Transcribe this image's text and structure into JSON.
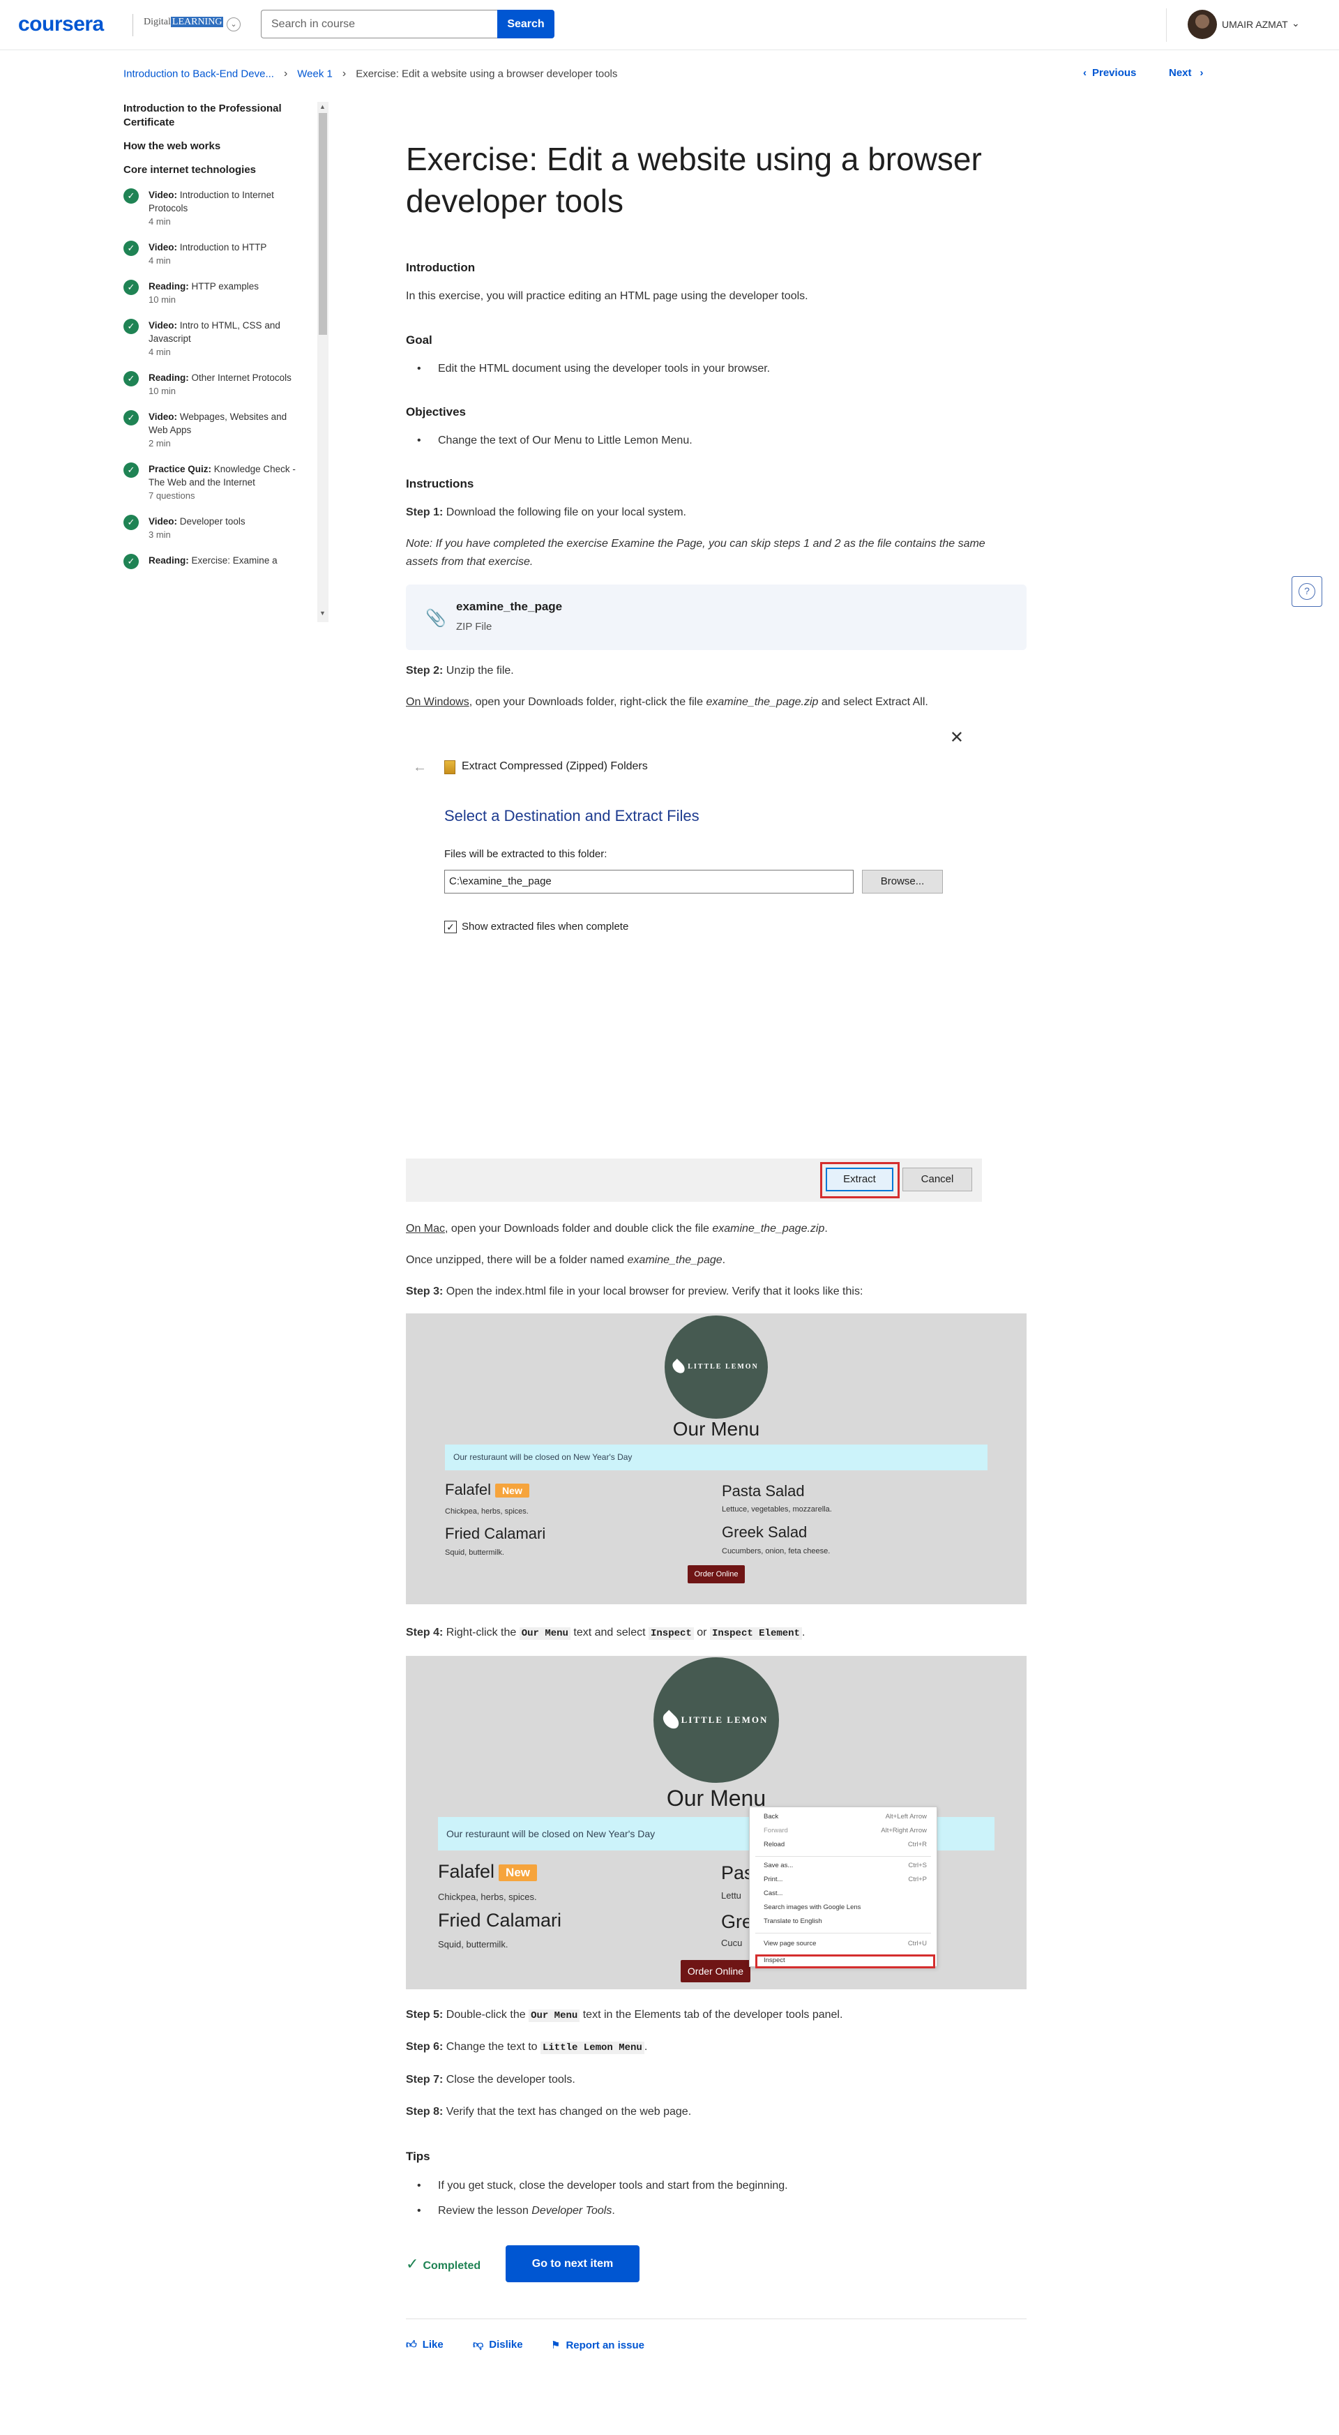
{
  "header": {
    "logo": "coursera",
    "partner_name_prefix": "Digital",
    "partner_name_highlight": "LEARNING",
    "search_placeholder": "Search in course",
    "search_button": "Search",
    "user_name": "UMAIR AZMAT"
  },
  "breadcrumb": {
    "items": [
      "Introduction to Back-End Deve...",
      "Week 1",
      "Exercise: Edit a website using a browser developer tools"
    ],
    "previous": "Previous",
    "next": "Next"
  },
  "sidebar": {
    "sections": [
      "Introduction to the Professional Certificate",
      "How the web works",
      "Core internet technologies"
    ],
    "items": [
      {
        "type": "Video:",
        "title": "Introduction to Internet Protocols",
        "meta": "4 min"
      },
      {
        "type": "Video:",
        "title": "Introduction to HTTP",
        "meta": "4 min"
      },
      {
        "type": "Reading:",
        "title": "HTTP examples",
        "meta": "10 min"
      },
      {
        "type": "Video:",
        "title": "Intro to HTML, CSS and Javascript",
        "meta": "4 min"
      },
      {
        "type": "Reading:",
        "title": "Other Internet Protocols",
        "meta": "10 min"
      },
      {
        "type": "Video:",
        "title": "Webpages, Websites and Web Apps",
        "meta": "2 min"
      },
      {
        "type": "Practice Quiz:",
        "title": "Knowledge Check - The Web and the Internet",
        "meta": "7 questions"
      },
      {
        "type": "Video:",
        "title": "Developer tools",
        "meta": "3 min"
      },
      {
        "type": "Reading:",
        "title": "Exercise: Examine a",
        "meta": ""
      }
    ]
  },
  "content": {
    "title": "Exercise: Edit a website using a browser developer tools",
    "intro_heading": "Introduction",
    "intro_text": "In this exercise, you will practice editing an HTML page using the developer tools.",
    "goal_heading": "Goal",
    "goal_item": "Edit the HTML document using the developer tools in your browser.",
    "objectives_heading": "Objectives",
    "objectives_item": "Change the text of Our Menu to Little Lemon Menu.",
    "instructions_heading": "Instructions",
    "step1_label": "Step 1:",
    "step1_text": " Download the following file on your local system.",
    "note_text": "Note: If you have completed the exercise Examine the Page, you can skip steps 1 and 2 as the file contains the same assets from that exercise.",
    "file_name": "examine_the_page",
    "file_type": "ZIP File",
    "step2_label": "Step 2:",
    "step2_text": " Unzip the file.",
    "windows_link": "On Windows",
    "windows_text_a": ", open your Downloads folder, right-click the file ",
    "windows_file": "examine_the_page.zip",
    "windows_text_b": " and select Extract All.",
    "mac_link": "On Mac",
    "mac_text_a": ", open your Downloads folder and double click the file ",
    "mac_file": "examine_the_page.zip",
    "mac_text_b": ".",
    "unzip_text_a": "Once unzipped, there will be a folder named ",
    "unzip_folder": "examine_the_page",
    "unzip_text_b": ".",
    "step3_label": "Step 3:",
    "step3_text": "  Open the index.html file in your local browser for preview. Verify that it looks like this:",
    "step4_label": "Step 4:",
    "step4_a": " Right-click the ",
    "step4_code1": "Our Menu",
    "step4_b": " text and select ",
    "step4_code2": "Inspect",
    "step4_c": " or ",
    "step4_code3": "Inspect Element",
    "step4_d": ".",
    "step5_label": "Step 5:",
    "step5_a": " Double-click the ",
    "step5_code": "Our Menu",
    "step5_b": " text in the Elements tab of the developer tools panel.",
    "step6_label": "Step 6:",
    "step6_a": " Change the text to ",
    "step6_code": "Little Lemon Menu",
    "step6_b": ".",
    "step7_label": "Step 7:",
    "step7_text": " Close the developer tools.",
    "step8_label": "Step 8:",
    "step8_text": " Verify that the text has changed on the web page.",
    "tips_heading": "Tips",
    "tip1": "If you get stuck, close the developer tools and start from the beginning.",
    "tip2_a": "Review the lesson ",
    "tip2_em": "Developer Tools",
    "tip2_b": "."
  },
  "dialog": {
    "caption": "Extract Compressed (Zipped) Folders",
    "heading": "Select a Destination and Extract Files",
    "label": "Files will be extracted to this folder:",
    "path": "C:\\examine_the_page",
    "browse": "Browse...",
    "checkbox_label": "Show extracted files when complete",
    "extract": "Extract",
    "cancel": "Cancel"
  },
  "little_lemon": {
    "logo_text": "LITTLE LEMON",
    "menu_title": "Our Menu",
    "notice": "Our resturaunt will be closed on New Year's Day",
    "dishes": [
      {
        "name": "Falafel",
        "badge": "New",
        "desc": "Chickpea, herbs, spices."
      },
      {
        "name": "Pasta Salad",
        "badge": "",
        "desc": "Lettuce, vegetables, mozzarella."
      },
      {
        "name": "Fried Calamari",
        "badge": "",
        "desc": "Squid, buttermilk."
      },
      {
        "name": "Greek Salad",
        "badge": "",
        "desc": "Cucumbers, onion, feta cheese."
      }
    ],
    "order_button": "Order Online",
    "partial_pasta": "Pas",
    "partial_pasta_desc": "Lettu",
    "partial_greek": "Gre",
    "partial_greek_desc": "Cucu"
  },
  "context_menu": {
    "items": [
      {
        "label": "Back",
        "shortcut": "Alt+Left Arrow"
      },
      {
        "label": "Forward",
        "shortcut": "Alt+Right Arrow"
      },
      {
        "label": "Reload",
        "shortcut": "Ctrl+R"
      },
      {
        "label": "Save as...",
        "shortcut": "Ctrl+S"
      },
      {
        "label": "Print...",
        "shortcut": "Ctrl+P"
      },
      {
        "label": "Cast...",
        "shortcut": ""
      },
      {
        "label": "Search images with Google Lens",
        "shortcut": ""
      },
      {
        "label": "Translate to English",
        "shortcut": ""
      },
      {
        "label": "View page source",
        "shortcut": "Ctrl+U"
      },
      {
        "label": "Inspect",
        "shortcut": ""
      }
    ]
  },
  "footer": {
    "completed": "Completed",
    "next_item": "Go to next item",
    "like": "Like",
    "dislike": "Dislike",
    "report": "Report an issue"
  }
}
